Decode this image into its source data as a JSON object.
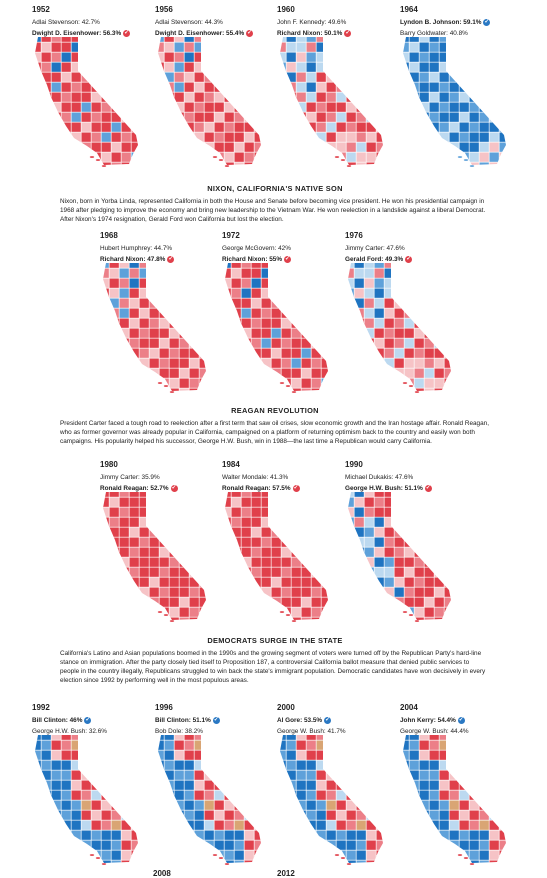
{
  "colors": {
    "rep_strong": "#e0404b",
    "rep_mid": "#ec7f88",
    "rep_light": "#f6c3c6",
    "dem_strong": "#1f74c1",
    "dem_mid": "#5ea1da",
    "dem_light": "#bcd9f0",
    "other": "#d9a574",
    "county_line": "#ffffff"
  },
  "row1": [
    {
      "year": "1952",
      "loser": "Adlai Stevenson: 42.7%",
      "winner": "Dwight D. Eisenhower: 56.3%",
      "party": "R",
      "fill": "r_heavy"
    },
    {
      "year": "1956",
      "loser": "Adlai Stevenson: 44.3%",
      "winner": "Dwight D. Eisenhower: 55.4%",
      "party": "R",
      "fill": "r_mixed"
    },
    {
      "year": "1960",
      "loser": "John F. Kennedy: 49.6%",
      "winner": "Richard Nixon: 50.1%",
      "party": "R",
      "fill": "split"
    },
    {
      "year": "1964",
      "winner": "Lyndon B. Johnson: 59.1%",
      "loser": "Barry Goldwater: 40.8%",
      "party": "D",
      "fill": "d_heavy"
    }
  ],
  "nixon": {
    "heading": "NIXON, CALIFORNIA'S NATIVE SON",
    "body": "Nixon, born in Yorba Linda, represented California in both the House and Senate before becoming vice president. He won his presidential campaign in 1968 after pledging to improve the economy and bring new leadership to the Vietnam War. He won reelection in a landslide against a liberal Democrat. After Nixon's 1974 resignation, Gerald Ford won California but lost the election.",
    "maps": [
      {
        "year": "1968",
        "loser": "Hubert Humphrey: 44.7%",
        "winner": "Richard Nixon: 47.8%",
        "party": "R",
        "fill": "r_mixed"
      },
      {
        "year": "1972",
        "loser": "George McGovern: 42%",
        "winner": "Richard Nixon: 55%",
        "party": "R",
        "fill": "r_heavy"
      },
      {
        "year": "1976",
        "loser": "Jimmy Carter: 47.6%",
        "winner": "Gerald Ford: 49.3%",
        "party": "R",
        "fill": "split"
      }
    ]
  },
  "reagan": {
    "heading": "REAGAN REVOLUTION",
    "body": "President Carter faced a tough road to reelection after a first term that saw oil crises, slow economic growth and the Iran hostage affair. Ronald Reagan, who as former governor was already popular in California, campaigned on a platform of returning optimism back to the country and easily won both campaigns. His popularity helped his successor, George H.W. Bush, win in 1988—the last time a Republican would carry California.",
    "maps": [
      {
        "year": "1980",
        "loser": "Jimmy Carter: 35.9%",
        "winner": "Ronald Reagan: 52.7%",
        "party": "R",
        "fill": "r_full"
      },
      {
        "year": "1984",
        "loser": "Walter Mondale: 41.3%",
        "winner": "Ronald Reagan: 57.5%",
        "party": "R",
        "fill": "r_full"
      },
      {
        "year": "1990",
        "loser": "Michael Dukakis: 47.6%",
        "winner": "George H.W. Bush: 51.1%",
        "party": "R",
        "fill": "r_coast_blue"
      }
    ]
  },
  "democrats": {
    "heading": "DEMOCRATS SURGE IN THE STATE",
    "body": "California's Latino and Asian populations boomed in the 1990s and the growing segment of voters were turned off by the Republican Party's hard-line stance on immigration. After the party closely tied itself to Proposition 187, a controversial California ballot measure that denied public services to people in the country illegally, Republicans struggled to win back the state's immigrant population. Democratic candidates have won decisively in every election since 1992 by performing well in the most populous areas.",
    "maps": [
      {
        "year": "1992",
        "winner": "Bill Clinton: 46%",
        "loser": "George H.W. Bush: 32.6%",
        "party": "D",
        "fill": "d_coast"
      },
      {
        "year": "1996",
        "winner": "Bill Clinton: 51.1%",
        "loser": "Bob Dole: 38.2%",
        "party": "D",
        "fill": "d_coast"
      },
      {
        "year": "2000",
        "winner": "Al Gore: 53.5%",
        "loser": "George W. Bush: 41.7%",
        "party": "D",
        "fill": "d_coast"
      },
      {
        "year": "2004",
        "winner": "John Kerry: 54.4%",
        "loser": "George W. Bush: 44.4%",
        "party": "D",
        "fill": "d_coast"
      }
    ]
  },
  "cut_years": [
    "2008",
    "2012"
  ],
  "check_glyph": "✓"
}
